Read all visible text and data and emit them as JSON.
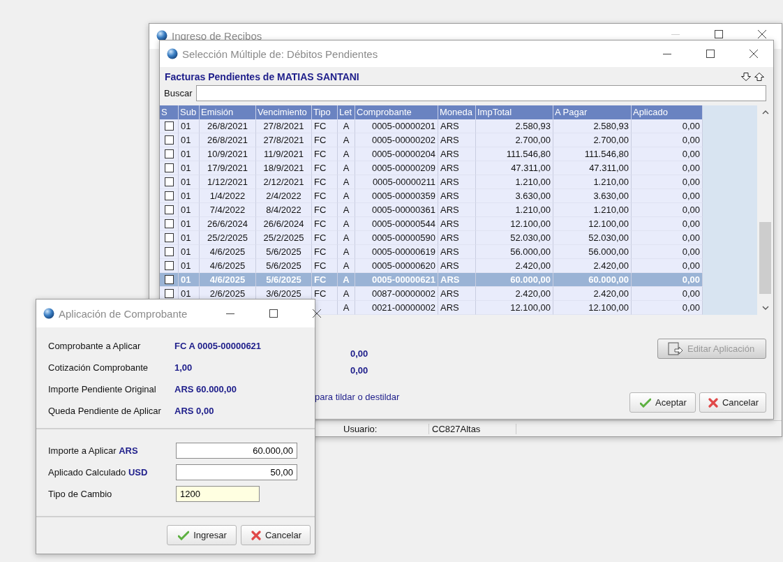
{
  "background_window": {
    "title": "Ingreso de Recibos",
    "status_bar": {
      "label": "Usuario:",
      "value": "CC827Altas"
    }
  },
  "selection_window": {
    "title": "Selección Múltiple de: Débitos Pendientes",
    "heading": "Facturas Pendientes de MATIAS SANTANI",
    "search": {
      "label": "Buscar"
    },
    "table": {
      "columns": [
        "S",
        "Sub",
        "Emisión",
        "Vencimiento",
        "Tipo",
        "Let",
        "Comprobante",
        "Moneda",
        "ImpTotal",
        "A Pagar",
        "Aplicado"
      ],
      "rows": [
        {
          "checked": false,
          "selected": false,
          "sub": "01",
          "emision": "26/8/2021",
          "vencimiento": "27/8/2021",
          "tipo": "FC",
          "let": "A",
          "comprobante": "0005-00000201",
          "moneda": "ARS",
          "imp_total": "2.580,93",
          "a_pagar": "2.580,93",
          "aplicado": "0,00"
        },
        {
          "checked": false,
          "selected": false,
          "sub": "01",
          "emision": "26/8/2021",
          "vencimiento": "27/8/2021",
          "tipo": "FC",
          "let": "A",
          "comprobante": "0005-00000202",
          "moneda": "ARS",
          "imp_total": "2.700,00",
          "a_pagar": "2.700,00",
          "aplicado": "0,00"
        },
        {
          "checked": false,
          "selected": false,
          "sub": "01",
          "emision": "10/9/2021",
          "vencimiento": "11/9/2021",
          "tipo": "FC",
          "let": "A",
          "comprobante": "0005-00000204",
          "moneda": "ARS",
          "imp_total": "111.546,80",
          "a_pagar": "111.546,80",
          "aplicado": "0,00"
        },
        {
          "checked": false,
          "selected": false,
          "sub": "01",
          "emision": "17/9/2021",
          "vencimiento": "18/9/2021",
          "tipo": "FC",
          "let": "A",
          "comprobante": "0005-00000209",
          "moneda": "ARS",
          "imp_total": "47.311,00",
          "a_pagar": "47.311,00",
          "aplicado": "0,00"
        },
        {
          "checked": false,
          "selected": false,
          "sub": "01",
          "emision": "1/12/2021",
          "vencimiento": "2/12/2021",
          "tipo": "FC",
          "let": "A",
          "comprobante": "0005-00000211",
          "moneda": "ARS",
          "imp_total": "1.210,00",
          "a_pagar": "1.210,00",
          "aplicado": "0,00"
        },
        {
          "checked": false,
          "selected": false,
          "sub": "01",
          "emision": "1/4/2022",
          "vencimiento": "2/4/2022",
          "tipo": "FC",
          "let": "A",
          "comprobante": "0005-00000359",
          "moneda": "ARS",
          "imp_total": "3.630,00",
          "a_pagar": "3.630,00",
          "aplicado": "0,00"
        },
        {
          "checked": false,
          "selected": false,
          "sub": "01",
          "emision": "7/4/2022",
          "vencimiento": "8/4/2022",
          "tipo": "FC",
          "let": "A",
          "comprobante": "0005-00000361",
          "moneda": "ARS",
          "imp_total": "1.210,00",
          "a_pagar": "1.210,00",
          "aplicado": "0,00"
        },
        {
          "checked": false,
          "selected": false,
          "sub": "01",
          "emision": "26/6/2024",
          "vencimiento": "26/6/2024",
          "tipo": "FC",
          "let": "A",
          "comprobante": "0005-00000544",
          "moneda": "ARS",
          "imp_total": "12.100,00",
          "a_pagar": "12.100,00",
          "aplicado": "0,00"
        },
        {
          "checked": false,
          "selected": false,
          "sub": "01",
          "emision": "25/2/2025",
          "vencimiento": "25/2/2025",
          "tipo": "FC",
          "let": "A",
          "comprobante": "0005-00000590",
          "moneda": "ARS",
          "imp_total": "52.030,00",
          "a_pagar": "52.030,00",
          "aplicado": "0,00"
        },
        {
          "checked": false,
          "selected": false,
          "sub": "01",
          "emision": "4/6/2025",
          "vencimiento": "5/6/2025",
          "tipo": "FC",
          "let": "A",
          "comprobante": "0005-00000619",
          "moneda": "ARS",
          "imp_total": "56.000,00",
          "a_pagar": "56.000,00",
          "aplicado": "0,00"
        },
        {
          "checked": false,
          "selected": false,
          "sub": "01",
          "emision": "4/6/2025",
          "vencimiento": "5/6/2025",
          "tipo": "FC",
          "let": "A",
          "comprobante": "0005-00000620",
          "moneda": "ARS",
          "imp_total": "2.420,00",
          "a_pagar": "2.420,00",
          "aplicado": "0,00"
        },
        {
          "checked": false,
          "selected": true,
          "sub": "01",
          "emision": "4/6/2025",
          "vencimiento": "5/6/2025",
          "tipo": "FC",
          "let": "A",
          "comprobante": "0005-00000621",
          "moneda": "ARS",
          "imp_total": "60.000,00",
          "a_pagar": "60.000,00",
          "aplicado": "0,00"
        },
        {
          "checked": false,
          "selected": false,
          "sub": "01",
          "emision": "2/6/2025",
          "vencimiento": "3/6/2025",
          "tipo": "FC",
          "let": "A",
          "comprobante": "0087-00000002",
          "moneda": "ARS",
          "imp_total": "2.420,00",
          "a_pagar": "2.420,00",
          "aplicado": "0,00"
        },
        {
          "selected": false,
          "let": "A",
          "comprobante": "0021-00000002",
          "moneda": "ARS",
          "imp_total": "12.100,00",
          "a_pagar": "12.100,00",
          "aplicado": "0,00"
        }
      ]
    },
    "totals": [
      "0,00",
      "0,00"
    ],
    "hint": "para tildar o destildar",
    "buttons": [
      {
        "label": "Editar Aplicación",
        "kind": "edit",
        "disabled": true
      },
      {
        "label": "Aceptar",
        "kind": "accept",
        "disabled": false
      },
      {
        "label": "Cancelar",
        "kind": "cancel",
        "disabled": false
      }
    ]
  },
  "application_dialog": {
    "title": "Aplicación de Comprobante",
    "info": [
      {
        "label": "Comprobante a Aplicar",
        "value": "FC A 0005-00000621"
      },
      {
        "label": "Cotización Comprobante",
        "value": "1,00"
      },
      {
        "label": "Importe Pendiente Original",
        "value": "ARS 60.000,00"
      },
      {
        "label": "Queda Pendiente de Aplicar",
        "value": "ARS 0,00"
      }
    ],
    "fields": [
      {
        "label": "Importe a Aplicar **ARS**",
        "value": "60.000,00",
        "highlighted": false
      },
      {
        "label": "Aplicado Calculado **USD**",
        "value": "50,00",
        "highlighted": false
      },
      {
        "label": "Tipo de Cambio",
        "value": "1200",
        "highlighted": true
      }
    ],
    "buttons": [
      {
        "label": "Ingresar",
        "kind": "accept"
      },
      {
        "label": "Cancelar",
        "kind": "cancel"
      }
    ]
  }
}
